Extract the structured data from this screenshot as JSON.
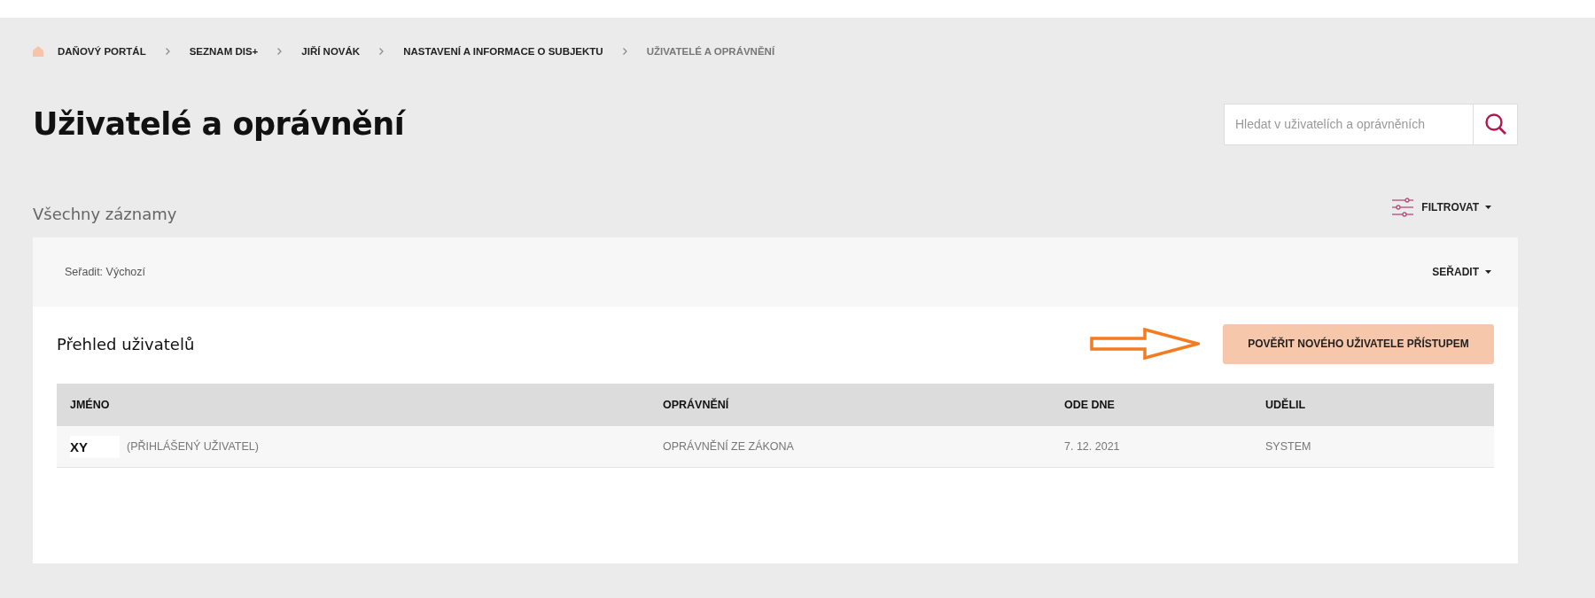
{
  "breadcrumb": [
    {
      "label": "DAŇOVÝ PORTÁL",
      "current": false
    },
    {
      "label": "SEZNAM DIS+",
      "current": false
    },
    {
      "label": "JIŘÍ NOVÁK",
      "current": false
    },
    {
      "label": "NASTAVENÍ A INFORMACE O SUBJEKTU",
      "current": false
    },
    {
      "label": "UŽIVATELÉ A OPRÁVNĚNÍ",
      "current": true
    }
  ],
  "title": "Uživatelé a oprávnění",
  "search": {
    "placeholder": "Hledat v uživatelích a oprávněních"
  },
  "section_title": "Všechny záznamy",
  "filter_button": "FILTROVAT",
  "sort_label": "Seřadit: Výchozí",
  "sort_button": "SEŘADIT",
  "panel_title": "Přehled uživatelů",
  "add_button": "POVĚŘIT NOVÉHO UŽIVATELE PŘÍSTUPEM",
  "table": {
    "columns": [
      "JMÉNO",
      "OPRÁVNĚNÍ",
      "ODE DNE",
      "UDĚLIL"
    ],
    "rows": [
      {
        "name": "XY",
        "note": "(PŘIHLÁŠENÝ UŽIVATEL)",
        "permission": "OPRÁVNĚNÍ ZE ZÁKONA",
        "since": "7. 12. 2021",
        "granted_by": "SYSTEM"
      }
    ]
  }
}
